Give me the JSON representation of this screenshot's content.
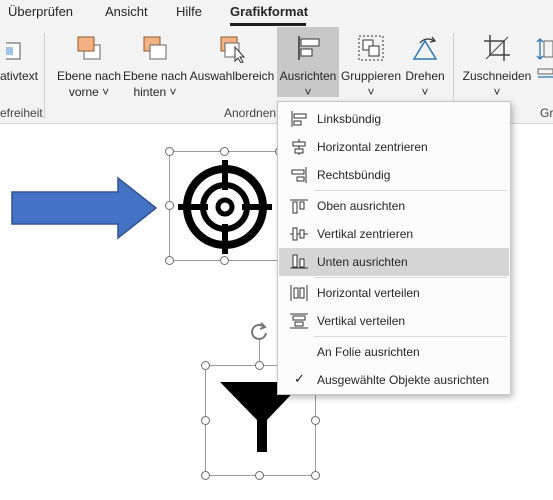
{
  "tabs": [
    {
      "label": "Überprüfen"
    },
    {
      "label": "Ansicht"
    },
    {
      "label": "Hilfe"
    },
    {
      "label": "Grafikformat"
    }
  ],
  "ribbon": {
    "alt_text": "ativtext",
    "accessibility_group": "efreiheit",
    "bring_forward": {
      "line1": "Ebene nach",
      "line2": "vorne ˅"
    },
    "send_backward": {
      "line1": "Ebene nach",
      "line2": "hinten ˅"
    },
    "selection_pane": "Auswahlbereich",
    "align": {
      "line1": "Ausrichten",
      "line2": "˅"
    },
    "group": {
      "line1": "Gruppieren",
      "line2": "˅"
    },
    "rotate": {
      "line1": "Drehen",
      "line2": "˅"
    },
    "arrange_group": "Anordnen",
    "crop": {
      "line1": "Zuschneiden",
      "line2": "˅"
    },
    "size_group": "Gr"
  },
  "align_menu": {
    "items": [
      {
        "label": "Linksbündig",
        "icon": "align-left-icon"
      },
      {
        "label": "Horizontal zentrieren",
        "icon": "align-center-icon"
      },
      {
        "label": "Rechtsbündig",
        "icon": "align-right-icon"
      },
      {
        "label": "Oben ausrichten",
        "icon": "align-top-icon"
      },
      {
        "label": "Vertikal zentrieren",
        "icon": "align-middle-icon"
      },
      {
        "label": "Unten ausrichten",
        "icon": "align-bottom-icon"
      },
      {
        "label": "Horizontal verteilen",
        "icon": "distribute-horizontal-icon"
      },
      {
        "label": "Vertikal verteilen",
        "icon": "distribute-vertical-icon"
      },
      {
        "label": "An Folie ausrichten",
        "icon": ""
      },
      {
        "label": "Ausgewählte Objekte ausrichten",
        "icon": "checkmark-icon",
        "checked": true
      }
    ],
    "hovered": "Unten ausrichten"
  },
  "colors": {
    "arrow_blue": "#4472c4",
    "arrow_border": "#2f528f",
    "accent_orange": "#f4b183",
    "icon_blue": "#2e75b6"
  }
}
